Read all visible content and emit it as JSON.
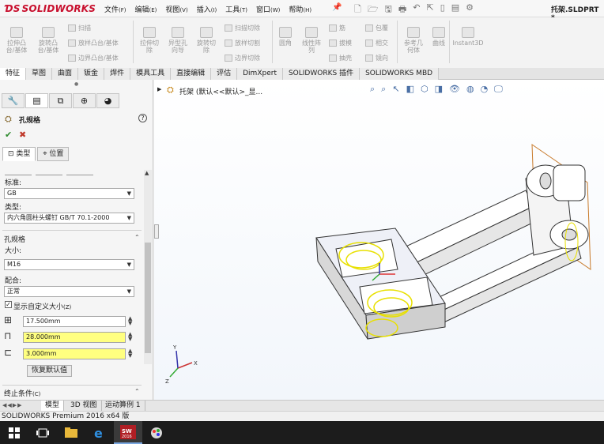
{
  "app": {
    "logo": "SOLIDWORKS",
    "document_title": "托架.SLDPRT *"
  },
  "menu": [
    {
      "label": "文件",
      "key": "(F)"
    },
    {
      "label": "编辑",
      "key": "(E)"
    },
    {
      "label": "视图",
      "key": "(V)"
    },
    {
      "label": "插入",
      "key": "(I)"
    },
    {
      "label": "工具",
      "key": "(T)"
    },
    {
      "label": "窗口",
      "key": "(W)"
    },
    {
      "label": "帮助",
      "key": "(H)"
    }
  ],
  "ribbon": {
    "extrude_boss": "拉伸凸\n台/基体",
    "revolve_boss": "旋转凸\n台/基体",
    "sweep": "扫描",
    "loft_boss": "放样凸台/基体",
    "boundary_boss": "边界凸台/基体",
    "extrude_cut": "拉伸切\n除",
    "hole_wizard": "异型孔\n向导",
    "revolve_cut": "旋转切\n除",
    "sweep_cut": "扫描切除",
    "loft_cut": "放样切割",
    "boundary_cut": "边界切除",
    "fillet": "圆角",
    "linear_pattern": "线性阵\n列",
    "rib": "筋",
    "draft": "拔模",
    "shell": "抽壳",
    "wrap": "包覆",
    "intersect": "相交",
    "mirror": "镜向",
    "ref_geometry": "参考几\n何体",
    "curves": "曲线",
    "instant3d": "Instant3D"
  },
  "command_tabs": [
    "特征",
    "草图",
    "曲面",
    "钣金",
    "焊件",
    "模具工具",
    "直接编辑",
    "评估",
    "DimXpert",
    "SOLIDWORKS 插件",
    "SOLIDWORKS MBD"
  ],
  "panel": {
    "title": "孔规格",
    "tabs": [
      "类型",
      "位置"
    ],
    "standard_label": "标准:",
    "standard_value": "GB",
    "type_label": "类型:",
    "type_value": "内六角圆柱头螺钉 GB/T 70.1-2000",
    "spec_header": "孔规格",
    "size_label": "大小:",
    "size_value": "M16",
    "fit_label": "配合:",
    "fit_value": "正常",
    "custom_size_label": "显示自定义大小",
    "custom_size_key": "(Z)",
    "custom_size_checked": true,
    "diameter": "17.500mm",
    "cbore_diameter": "28.000mm",
    "cbore_depth": "3.000mm",
    "reset_label": "恢复默认值",
    "end_condition_header": "终止条件",
    "end_condition_key": "(C)"
  },
  "graphics": {
    "tree_text": "托架 (默认<<默认>_显..."
  },
  "bottom_tabs": [
    "模型",
    "3D 视图",
    "运动算例 1"
  ],
  "status": "SOLIDWORKS Premium 2016 x64 版",
  "colors": {
    "brand": "#c8102e",
    "highlight_field": "#ffff80",
    "selection_yellow": "#e8e000",
    "plane_orange": "#c87a2a"
  }
}
